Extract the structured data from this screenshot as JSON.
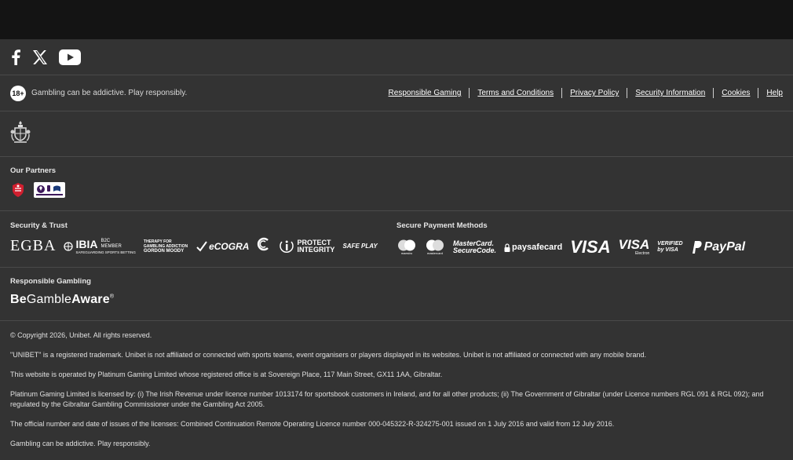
{
  "social": {
    "icons": [
      "facebook-icon",
      "x-icon",
      "youtube-icon"
    ]
  },
  "rg_bar": {
    "age_badge": "18+",
    "message": "Gambling can be addictive. Play responsibly.",
    "links": [
      "Responsible Gaming",
      "Terms and Conditions",
      "Privacy Policy",
      "Security Information",
      "Cookies",
      "Help"
    ]
  },
  "partners": {
    "heading": "Our Partners"
  },
  "security": {
    "heading": "Security & Trust",
    "egba": "EGBA",
    "ibia": "IBIA",
    "ibia_sub1": "B2C",
    "ibia_sub2": "MEMBER",
    "ibia_sub3": "SAFEGUARDING SPORTS BETTING",
    "gordon1": "THERAPY FOR",
    "gordon2": "GAMBLING ADDICTION",
    "gordon3": "GORDON MOODY",
    "ecogra": "eCOGRA",
    "protect1": "PROTECT",
    "protect2": "INTEGRITY",
    "safe_play": "SAFE PLAY"
  },
  "payments": {
    "heading": "Secure Payment Methods",
    "maestro": "maestro",
    "mastercard": "mastercard",
    "securecode1": "MasterCard.",
    "securecode2": "SecureCode.",
    "paysafe": "paysafecard",
    "visa": "VISA",
    "visa_electron": "VISA",
    "electron": "Electron",
    "verified1": "VERIFIED",
    "verified2": "by VISA",
    "paypal": "PayPal"
  },
  "responsible": {
    "heading": "Responsible Gambling",
    "be": "Be",
    "gamble": "Gamble",
    "aware": "Aware",
    "reg": "®"
  },
  "legal": {
    "copyright": "© Copyright 2026, Unibet. All rights reserved.",
    "trademark": "\"UNIBET\" is a registered trademark. Unibet is not affiliated or connected with sports teams, event organisers or players displayed in its websites. Unibet is not affiliated or connected with any mobile brand.",
    "operator": "This website is operated by Platinum Gaming Limited whose registered office is at Sovereign Place, 117 Main Street, GX11 1AA, Gibraltar.",
    "license": "Platinum Gaming Limited is licensed by: (i) The Irish Revenue under licence number 1013174 for sportsbook customers in Ireland, and for all other products; (ii) The Government of Gibraltar (under Licence numbers RGL 091 & RGL 092); and regulated by the Gibraltar Gambling Commissioner under the Gambling Act 2005.",
    "official": "The official number and date of issues of the licenses: Combined Continuation Remote Operating Licence number 000-045322-R-324275-001 issued on 1 July 2016 and valid from 12 July 2016.",
    "addictive": "Gambling can be addictive. Play responsibly."
  }
}
